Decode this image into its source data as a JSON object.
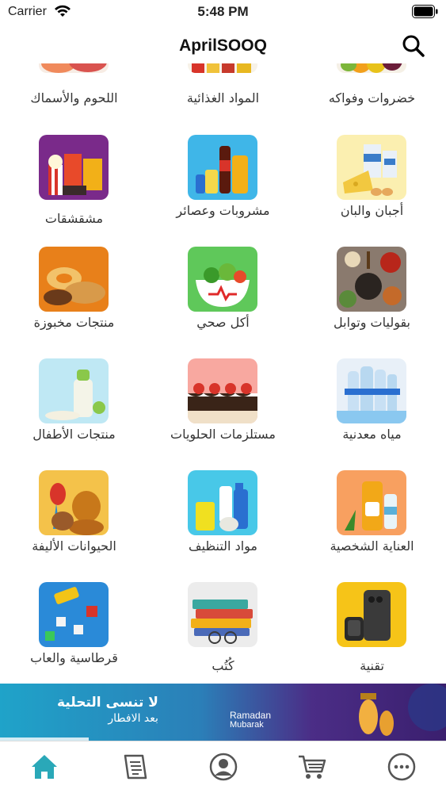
{
  "status_bar": {
    "carrier": "Carrier",
    "time": "5:48 PM"
  },
  "nav": {
    "title": "AprilSOOQ"
  },
  "categories": [
    {
      "label": "خضروات وفواكه"
    },
    {
      "label": "المواد الغذائية"
    },
    {
      "label": "اللحوم والأسماك"
    },
    {
      "label": "أجبان والبان"
    },
    {
      "label": "مشروبات وعصائر"
    },
    {
      "label": "مشقشقات"
    },
    {
      "label": "بقوليات وتوابل"
    },
    {
      "label": "أكل صحي"
    },
    {
      "label": "منتجات مخبوزة"
    },
    {
      "label": "مياه معدنية"
    },
    {
      "label": "مستلزمات الحلويات"
    },
    {
      "label": "منتجات الأطفال"
    },
    {
      "label": "العناية الشخصية"
    },
    {
      "label": "مواد التنظيف"
    },
    {
      "label": "الحيوانات الأليفة"
    },
    {
      "label": "تقنية"
    },
    {
      "label": "كُتُب"
    },
    {
      "label": "قرطاسية والعاب"
    }
  ],
  "banner": {
    "line1": "لا تنسى التحلية",
    "line2": "بعد الافطار",
    "ramadan": "Ramadan",
    "mubarak": "Mubarak"
  },
  "tabs": [
    "home",
    "orders",
    "account",
    "cart",
    "more"
  ],
  "colors": {
    "accent": "#2aa8b8",
    "banner_left": "#1fa3c9",
    "banner_right": "#4b2d86"
  }
}
